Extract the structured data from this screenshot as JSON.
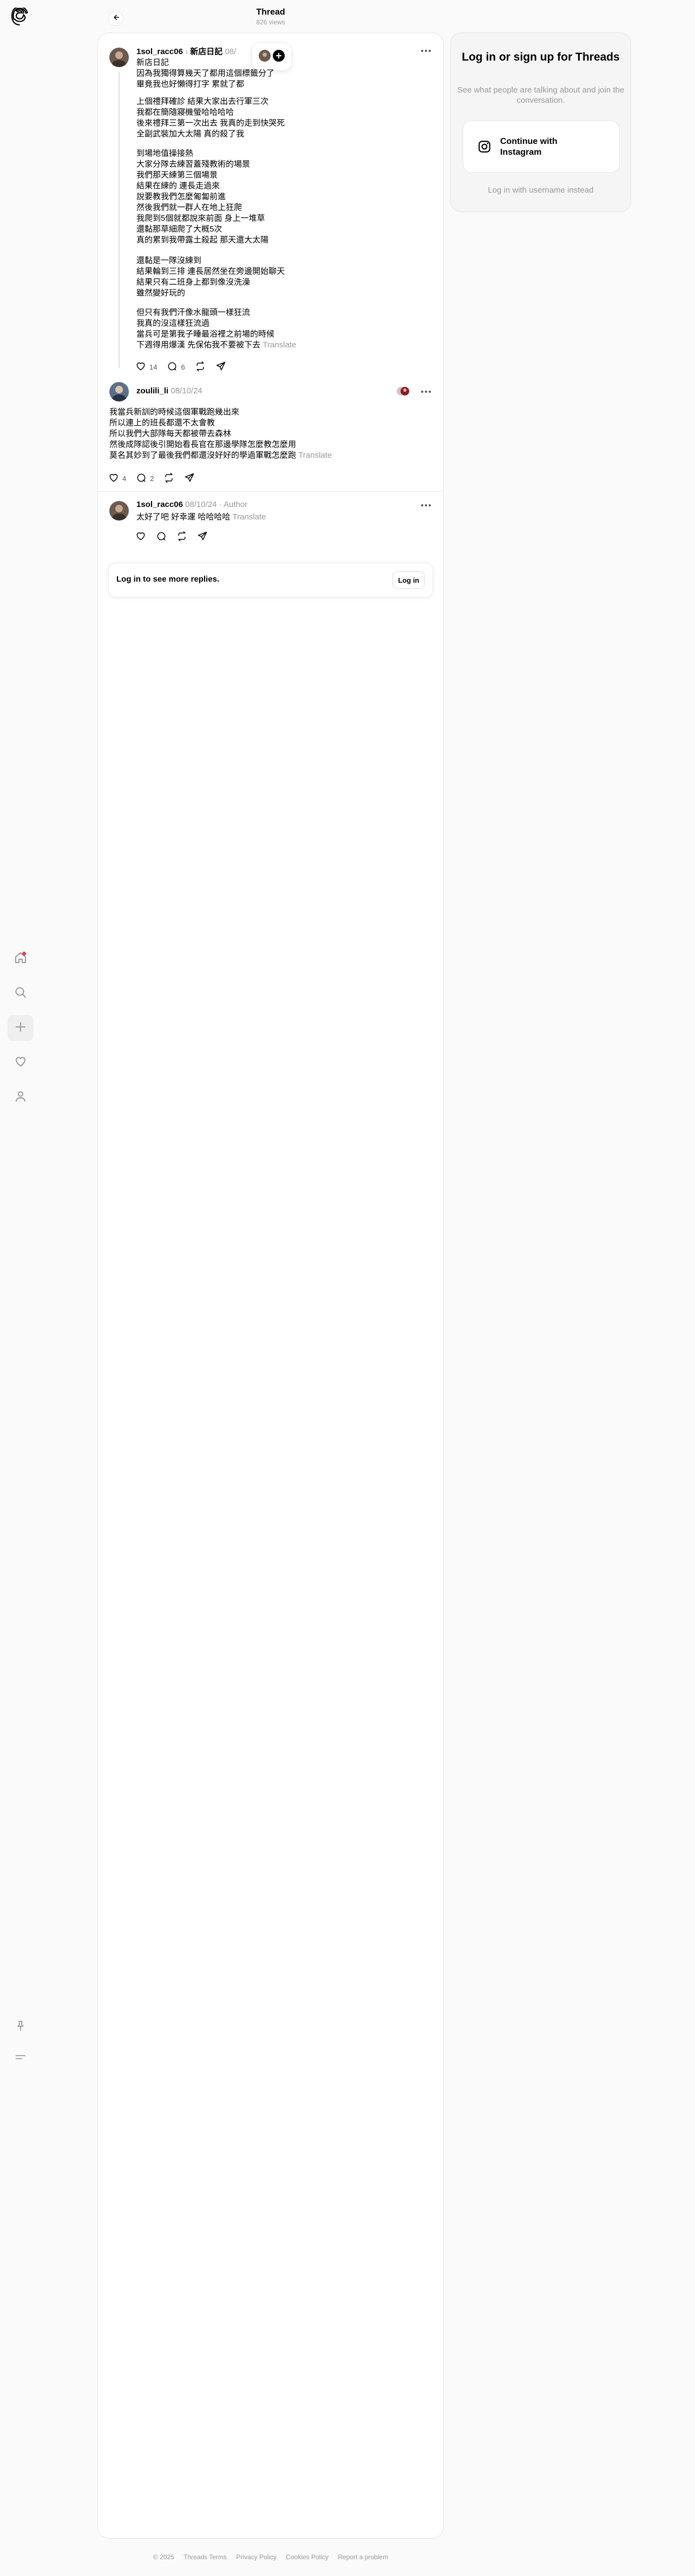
{
  "header": {
    "title": "Thread",
    "views": "826 views"
  },
  "nav": {
    "items": [
      "home-icon",
      "search-icon",
      "create-icon",
      "activity-icon",
      "profile-icon"
    ],
    "bottom": [
      "pin-icon",
      "menu-icon"
    ]
  },
  "post": {
    "username": "1sol_racc06",
    "tag": "新店日記",
    "date_partial": "08/",
    "paragraphs": [
      "新店日記\n因為我獨得算幾天了都用這個標籤分了\n畢竟我也好懶得打字 累就了都",
      "上個禮拜確診 結果大家出去行軍三次\n我都在簡隨寢機螢哈哈哈哈\n後來禮拜三第一次出去 我真的走到快哭死\n全副武裝加大太陽 真的殺了我",
      "到場地值操接熱\n大家分隊去練習蓋殘教術的場景\n我們那天練第三個場景\n結果在練的 連長走過來\n說要教我們怎麼匍匐前進\n然後我們就一群人在地上狂爬\n我爬到5個就都說來前面 身上一堆草\n還黏那草細爬了大概5次\n真的累到我帶露土殺起 那天還大太陽",
      "還黏是一隊沒練到\n結果輪到三排 連長居然坐在旁邊開始聊天\n結果只有二班身上都到像沒洗澡\n雖然變好玩的",
      "但只有我們汗像水龍頭一樣狂流\n我真的沒這樣狂流過\n當兵可是第我子睡最浴裡之前場的時候\n下週得用爆漢 先保佑我不要被下去"
    ],
    "translate": "Translate",
    "likes": "14",
    "replies": "6"
  },
  "reply1": {
    "username": "zoulili_li",
    "date": "08/10/24",
    "lines": [
      "我當兵新訓的時候這個軍戰跑幾出來",
      "所以連上的班長都還不太會教",
      "所以我們大部隊每天都被帶去森林",
      "然後成隊認後引開始看長官在那邊學隊怎麼教怎麼用",
      "莫名其妙到了最後我們都還沒好好的學過軍戰怎麼跑"
    ],
    "translate": "Translate",
    "likes": "4",
    "replies": "2"
  },
  "reply2": {
    "username": "1sol_racc06",
    "date": "08/10/24",
    "author": "Author",
    "text": "太好了吧 好幸運 哈哈哈哈",
    "translate": "Translate"
  },
  "login_prompt": {
    "text": "Log in to see more replies.",
    "button": "Log in"
  },
  "card": {
    "title": "Log in or sign up for Threads",
    "subtitle": "See what people are talking about and join the conversation.",
    "instagram_button": "Continue with Instagram",
    "username_link": "Log in with username instead"
  },
  "footer": [
    "© 2025",
    "Threads Terms",
    "Privacy Policy",
    "Cookies Policy",
    "Report a problem"
  ],
  "colors": {
    "notification": "#ff3040",
    "muted": "#999999",
    "border": "#e4e4e4"
  }
}
